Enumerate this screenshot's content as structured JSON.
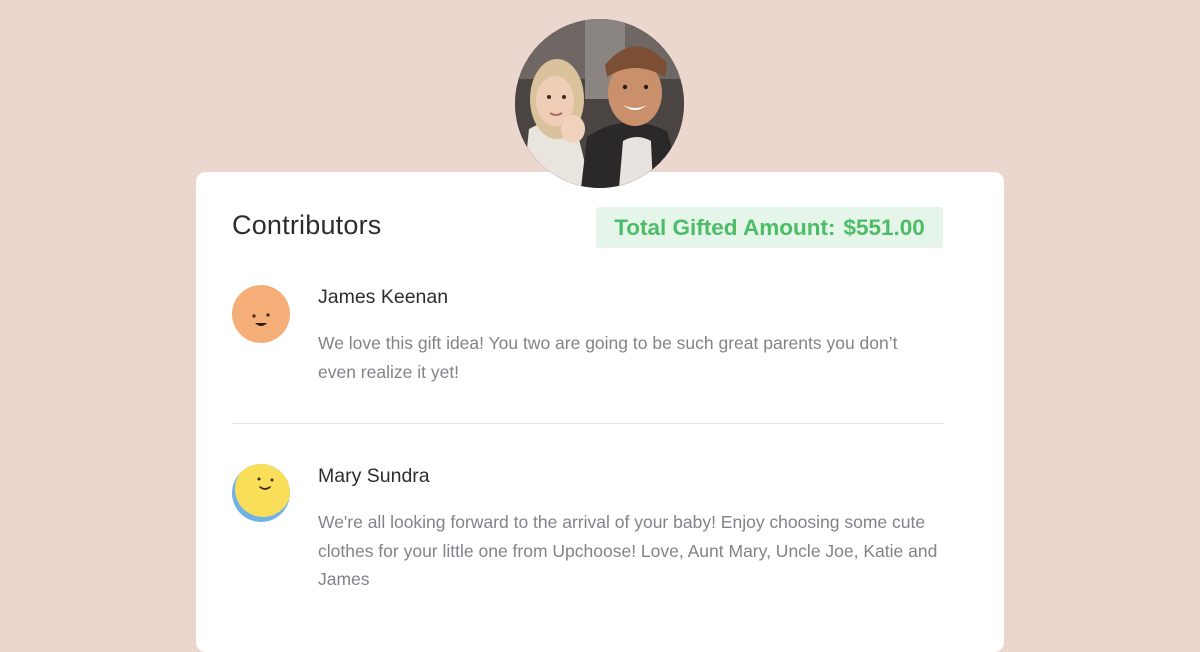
{
  "header_photo": {
    "icon": "couple-photo",
    "alt": "Couple photo"
  },
  "contributors_card": {
    "title": "Contributors",
    "total_label": "Total Gifted Amount:",
    "total_amount": "$551.00",
    "accent_color": "#4cbc67",
    "accent_bg": "#e6f5ea"
  },
  "contributors": [
    {
      "name": "James Keenan",
      "avatar_icon": "smiley-orange-avatar",
      "avatar_color": "#f5ae78",
      "message": "We love this gift idea! You two are going to be such great parents you don’t even realize it yet!"
    },
    {
      "name": "Mary Sundra",
      "avatar_icon": "smiley-yellow-avatar",
      "avatar_color": "#f8de59",
      "message": "We're all looking forward to the arrival of your baby! Enjoy choosing some cute clothes for your little one from Upchoose! Love, Aunt Mary, Uncle Joe, Katie and James"
    }
  ]
}
